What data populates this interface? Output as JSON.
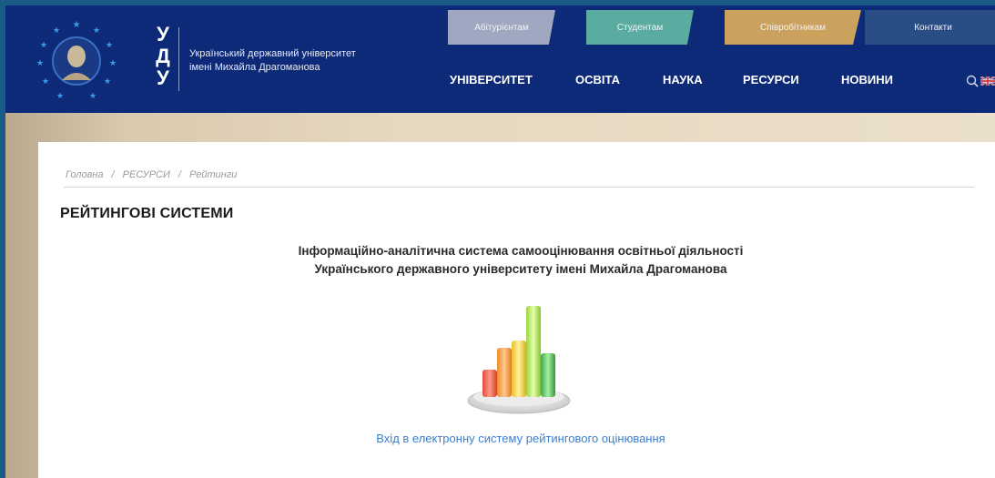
{
  "header": {
    "logo_letters": [
      "У",
      "Д",
      "У"
    ],
    "logo_name_line1": "Український державний університет",
    "logo_name_line2": "імені Михайла Драгоманова",
    "top_tabs": [
      {
        "label": "Абітурієнтам",
        "color": "#a9aec4"
      },
      {
        "label": "Студентам",
        "color": "#5fb3a3"
      },
      {
        "label": "Співробітникам",
        "color": "#d5a85c"
      },
      {
        "label": "Контакти",
        "color": "#2b4f86"
      }
    ],
    "nav": [
      "УНІВЕРСИТЕТ",
      "ОСВІТА",
      "НАУКА",
      "РЕСУРСИ",
      "НОВИНИ"
    ],
    "search_icon": "search-icon",
    "language_icon": "uk-flag-icon"
  },
  "breadcrumb": {
    "home": "Головна",
    "sep1": "/",
    "section": "РЕСУРСИ",
    "sep2": "/",
    "current": "Рейтинги"
  },
  "page": {
    "title": "РЕЙТИНГОВІ СИСТЕМИ",
    "subtitle_line1": "Інформаційно-аналітична система самооцінювання освітньої діяльності",
    "subtitle_line2": "Українського державного університету імені Михайла Драгоманова",
    "link": "Вхід в електронну систему рейтингового оцінювання"
  },
  "colors": {
    "header_bg": "#0d2a78",
    "link": "#3a7fd0",
    "accent_gold": "#d5a85c"
  }
}
